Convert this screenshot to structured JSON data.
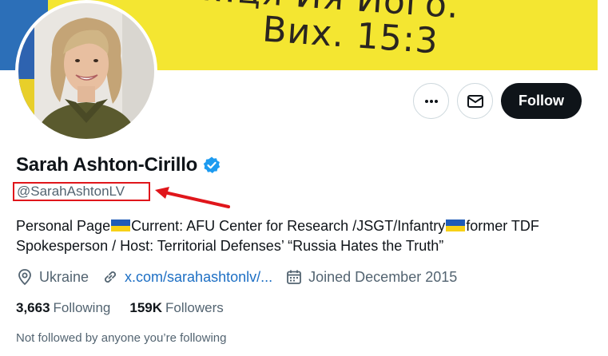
{
  "banner": {
    "line1": "…ця Йя Його.",
    "line2": "Вих. 15:3"
  },
  "profile": {
    "name": "Sarah Ashton-Cirillo",
    "handle": "@SarahAshtonLV",
    "bio_part1": "Personal Page",
    "bio_part2": "Current: AFU Center for Research /JSGT/Infantry",
    "bio_part3": "former TDF Spokesperson / Host: Territorial Defenses’ “Russia Hates the Truth”",
    "location": "Ukraine",
    "link": "x.com/sarahashtonlv/...",
    "joined": "Joined December 2015",
    "following_count": "3,663",
    "following_label": "Following",
    "followers_count": "159K",
    "followers_label": "Followers",
    "not_followed_text": "Not followed by anyone you’re following"
  },
  "actions": {
    "follow_label": "Follow"
  },
  "icons": {
    "more": "more-icon",
    "message": "mail-icon",
    "verified": "verified-badge-icon",
    "location": "location-pin-icon",
    "link": "link-icon",
    "calendar": "calendar-icon",
    "annotation": "red-arrow-icon",
    "flag": "ukraine-flag-icon"
  },
  "colors": {
    "accent": "#1d9bf0",
    "annotation": "#e0161b",
    "follow_bg": "#0f1419",
    "flag_blue": "#1e5bb8",
    "flag_yellow": "#f7d117"
  }
}
